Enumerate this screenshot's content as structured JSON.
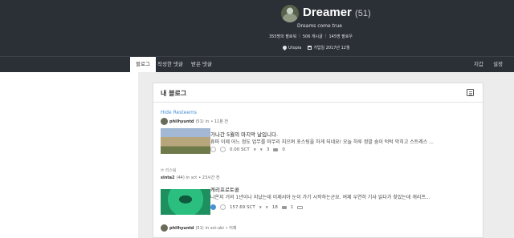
{
  "profile": {
    "name": "Dreamer",
    "reputation": "(51)",
    "about": "Dreams come true",
    "followers": "355명의 팔로워",
    "posts": "506 게시글",
    "following": "145명 팔로우",
    "location": "Utopia",
    "joined": "가입일 2017년 12월",
    "icons": {
      "location": "pin-icon",
      "joined": "calendar-icon"
    }
  },
  "tabs": [
    {
      "label": "블로그",
      "active": true
    },
    {
      "label": "작성한 댓글",
      "active": false
    },
    {
      "label": "받은 댓글",
      "active": false
    }
  ],
  "tabs_right": [
    {
      "label": "지갑"
    },
    {
      "label": "설정"
    }
  ],
  "feed": {
    "title": "내 블로그",
    "hide_resteems": "Hide Resteems",
    "posts": [
      {
        "author": "philhyuntd",
        "author_rep": "(51)",
        "category": "in",
        "time": "• 11분 전",
        "title": "가나간 5월의 마지막 날입니다.",
        "body": "휴퍼 이제 어느 정도 업무를 마무리 지으며 포스팅을 하게 되네요! 오늘 하루 정말 숨이 턱턱 막히고 스트레스 ...",
        "payout": "0.00 SCT",
        "votes": "3",
        "comments": "0",
        "thumb_colors": [
          "#a3b8d4",
          "#b7a57c",
          "#6f7a4b"
        ]
      },
      {
        "resteem_label": "리스팀",
        "author": "sinta2",
        "author_rep": "(44)",
        "category": "in sct",
        "time": "• 23시간 전",
        "title": "캐리프로토콜",
        "body": "나온지 거의 1년이나 지났는데 이제서야 눈이 가기 시작하는군요. 여제 우연히 기사 읽다가 찾았는데 캐리프...",
        "payout": "157.69 SCT",
        "votes": "18",
        "comments": "1",
        "thumb_colors": [
          "#2bbf7f",
          "#1e8f5e"
        ]
      },
      {
        "author": "philhyuntd",
        "author_rep": "(51)",
        "category": "in sct-ubi",
        "time": "• 어제"
      }
    ]
  }
}
